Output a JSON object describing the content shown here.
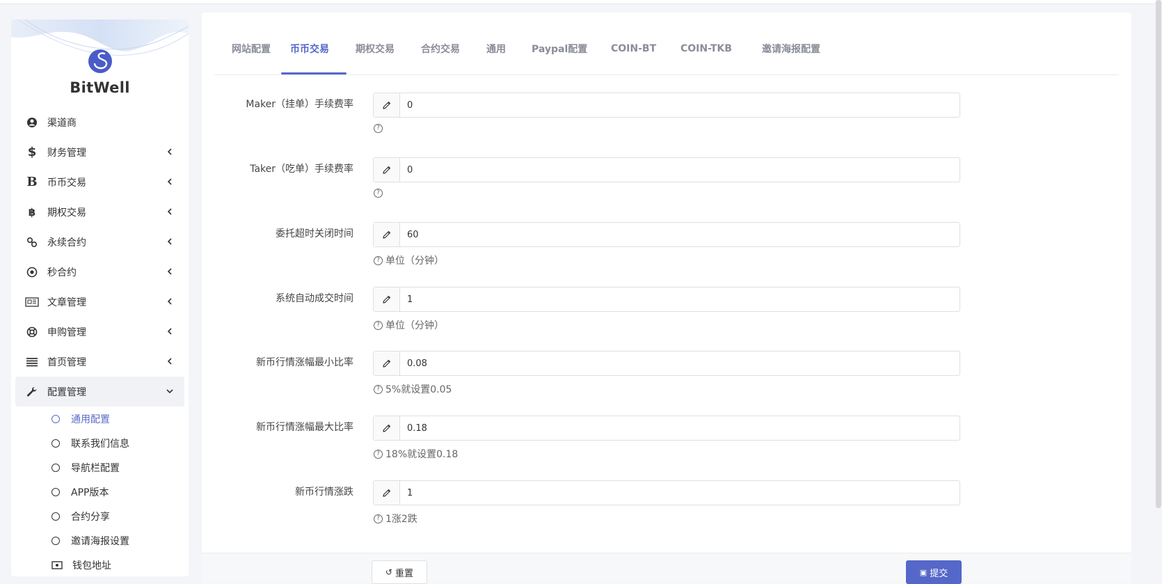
{
  "brand": {
    "name": "BitWell"
  },
  "sidebar": {
    "items": [
      {
        "label": "渠道商",
        "icon": "user-circle-icon",
        "has_chevron": false
      },
      {
        "label": "财务管理",
        "icon": "dollar-icon",
        "has_chevron": true
      },
      {
        "label": "币币交易",
        "icon": "letter-b-icon",
        "has_chevron": true
      },
      {
        "label": "期权交易",
        "icon": "bitcoin-icon",
        "has_chevron": true
      },
      {
        "label": "永续合约",
        "icon": "link-icon",
        "has_chevron": true
      },
      {
        "label": "秒合约",
        "icon": "dot-circle-icon",
        "has_chevron": true
      },
      {
        "label": "文章管理",
        "icon": "newspaper-icon",
        "has_chevron": true
      },
      {
        "label": "申购管理",
        "icon": "lifebuoy-icon",
        "has_chevron": true
      },
      {
        "label": "首页管理",
        "icon": "list-icon",
        "has_chevron": true
      },
      {
        "label": "配置管理",
        "icon": "wrench-icon",
        "has_chevron": true,
        "expanded": true
      }
    ],
    "sub_items": [
      {
        "label": "通用配置",
        "current": true
      },
      {
        "label": "联系我们信息"
      },
      {
        "label": "导航栏配置"
      },
      {
        "label": "APP版本"
      },
      {
        "label": "合约分享"
      },
      {
        "label": "邀请海报设置"
      },
      {
        "label": "钱包地址",
        "icon": "wallet-icon"
      }
    ]
  },
  "tabs": [
    {
      "label": "网站配置"
    },
    {
      "label": "币币交易",
      "active": true
    },
    {
      "label": "期权交易"
    },
    {
      "label": "合约交易"
    },
    {
      "label": "通用"
    },
    {
      "label": "Paypal配置"
    },
    {
      "label": "COIN-BT"
    },
    {
      "label": "COIN-TKB"
    },
    {
      "label": "邀请海报配置"
    }
  ],
  "form": {
    "fields": [
      {
        "label": "Maker（挂单）手续费率",
        "value": "0",
        "help": ""
      },
      {
        "label": "Taker（吃单）手续费率",
        "value": "0",
        "help": ""
      },
      {
        "label": "委托超时关闭时间",
        "value": "60",
        "help": "单位（分钟）"
      },
      {
        "label": "系统自动成交时间",
        "value": "1",
        "help": "单位（分钟）"
      },
      {
        "label": "新币行情涨幅最小比率",
        "value": "0.08",
        "help": "5%就设置0.05"
      },
      {
        "label": "新币行情涨幅最大比率",
        "value": "0.18",
        "help": "18%就设置0.18"
      },
      {
        "label": "新币行情涨跌",
        "value": "1",
        "help": "1涨2跌"
      }
    ]
  },
  "buttons": {
    "reset": "重置",
    "submit": "提交"
  },
  "colors": {
    "accent": "#5567c9",
    "background": "#f4f5f9"
  }
}
